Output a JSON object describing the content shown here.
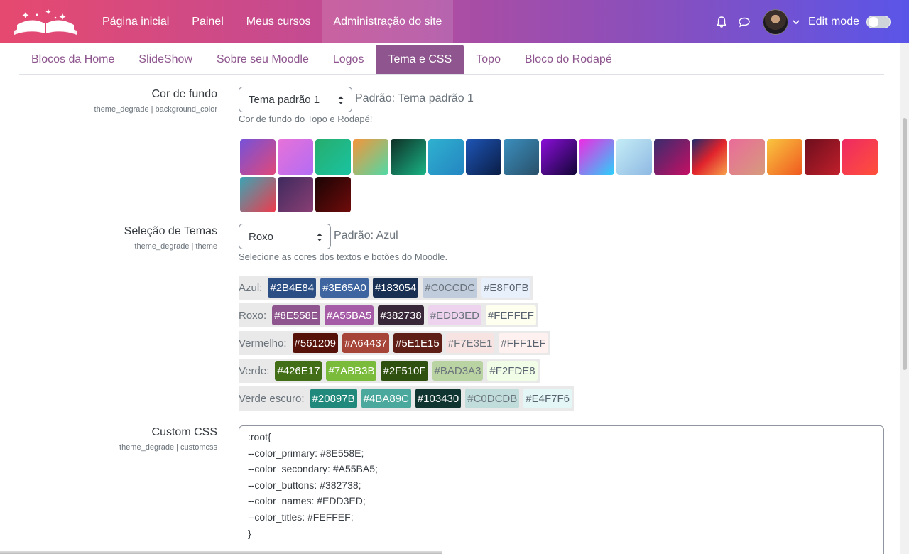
{
  "navbar": {
    "links": [
      "Página inicial",
      "Painel",
      "Meus cursos",
      "Administração do site"
    ],
    "active_index": 3,
    "edit_mode_label": "Edit mode"
  },
  "tabs": {
    "items": [
      "Blocos da Home",
      "SlideShow",
      "Sobre seu Moodle",
      "Logos",
      "Tema e CSS",
      "Topo",
      "Bloco do Rodapé"
    ],
    "active_index": 4
  },
  "background_color": {
    "label": "Cor de fundo",
    "key": "theme_degrade | background_color",
    "selected": "Tema padrão 1",
    "default_text": "Padrão: Tema padrão 1",
    "description": "Cor de fundo do Topo e Rodapé!",
    "swatches": [
      [
        "#7652d8",
        "#e0487a"
      ],
      [
        "#e772d8",
        "#b46cf4"
      ],
      [
        "#27ad6d",
        "#19c3a1"
      ],
      [
        "#f5953a",
        "#4fd9a6"
      ],
      [
        "#0f2f26",
        "#19b384"
      ],
      [
        "#2fb1cf",
        "#2486c2"
      ],
      [
        "#1e55b6",
        "#0a1d45"
      ],
      [
        "#3b8fbe",
        "#29506a"
      ],
      [
        "#8a0ed8",
        "#130537"
      ],
      [
        "#f02ae2",
        "#2ad0fa"
      ],
      [
        "#c4ecf6",
        "#8fb9e3"
      ],
      [
        "#392c6e",
        "#c50f63"
      ],
      [
        "#1d2a6b",
        "#e1232c",
        "#f7a14a"
      ],
      [
        "#ea6b9a",
        "#d69b7c"
      ],
      [
        "#f9c640",
        "#f0581f"
      ],
      [
        "#6d0e1d",
        "#c01f2b"
      ],
      [
        "#ee2a63",
        "#ff503a"
      ],
      [
        "#3aa5b4",
        "#f03a4c"
      ],
      [
        "#3e2a5e",
        "#8a3f74"
      ],
      [
        "#1a0404",
        "#700b0b"
      ]
    ]
  },
  "theme_selection": {
    "label": "Seleção de Temas",
    "key": "theme_degrade | theme",
    "selected": "Roxo",
    "default_text": "Padrão: Azul",
    "description": "Selecione as cores dos textos e botões do Moodle.",
    "themes": [
      {
        "name": "Azul:",
        "colors": [
          {
            "hex": "#2B4E84",
            "bg": "#2B4E84",
            "fg": "#ffffff"
          },
          {
            "hex": "#3E65A0",
            "bg": "#3E65A0",
            "fg": "#ffffff"
          },
          {
            "hex": "#183054",
            "bg": "#183054",
            "fg": "#ffffff"
          },
          {
            "hex": "#C0CCDC",
            "bg": "#C0CCDC",
            "fg": "#6a737b"
          },
          {
            "hex": "#E8F0FB",
            "bg": "#E8F0FB",
            "fg": "#5a6470"
          }
        ]
      },
      {
        "name": "Roxo:",
        "colors": [
          {
            "hex": "#8E558E",
            "bg": "#8E558E",
            "fg": "#ffffff"
          },
          {
            "hex": "#A55BA5",
            "bg": "#A55BA5",
            "fg": "#ffffff"
          },
          {
            "hex": "#382738",
            "bg": "#382738",
            "fg": "#ffffff"
          },
          {
            "hex": "#EDD3ED",
            "bg": "#EDD3ED",
            "fg": "#6a737b"
          },
          {
            "hex": "#FEFFEF",
            "bg": "#FEFFEF",
            "fg": "#5a6470"
          }
        ]
      },
      {
        "name": "Vermelho:",
        "colors": [
          {
            "hex": "#561209",
            "bg": "#561209",
            "fg": "#ffffff"
          },
          {
            "hex": "#A64437",
            "bg": "#A64437",
            "fg": "#ffffff"
          },
          {
            "hex": "#5E1E15",
            "bg": "#5E1E15",
            "fg": "#ffffff"
          },
          {
            "hex": "#F7E3E1",
            "bg": "#F7E3E1",
            "fg": "#6a737b"
          },
          {
            "hex": "#FFF1EF",
            "bg": "#FFF1EF",
            "fg": "#5a6470"
          }
        ]
      },
      {
        "name": "Verde:",
        "colors": [
          {
            "hex": "#426E17",
            "bg": "#426E17",
            "fg": "#ffffff"
          },
          {
            "hex": "#7ABB3B",
            "bg": "#7ABB3B",
            "fg": "#ffffff"
          },
          {
            "hex": "#2F510F",
            "bg": "#2F510F",
            "fg": "#ffffff"
          },
          {
            "hex": "#BAD3A3",
            "bg": "#BAD3A3",
            "fg": "#6a737b"
          },
          {
            "hex": "#F2FDE8",
            "bg": "#F2FDE8",
            "fg": "#5a6470"
          }
        ]
      },
      {
        "name": "Verde escuro:",
        "colors": [
          {
            "hex": "#20897B",
            "bg": "#20897B",
            "fg": "#ffffff"
          },
          {
            "hex": "#4BA89C",
            "bg": "#4BA89C",
            "fg": "#ffffff"
          },
          {
            "hex": "#103430",
            "bg": "#103430",
            "fg": "#ffffff"
          },
          {
            "hex": "#C0DCDB",
            "bg": "#C0DCDB",
            "fg": "#6a737b"
          },
          {
            "hex": "#E4F7F6",
            "bg": "#E4F7F6",
            "fg": "#5a6470"
          }
        ]
      }
    ]
  },
  "custom_css": {
    "label": "Custom CSS",
    "key": "theme_degrade | customcss",
    "lines": [
      ":root{",
      "--color_primary: #8E558E;",
      "--color_secondary: #A55BA5;",
      "--color_buttons: #382738;",
      "--color_names: #EDD3ED;",
      "--color_titles: #FEFFEF;",
      "}"
    ]
  },
  "accent_color": "#8E558E"
}
